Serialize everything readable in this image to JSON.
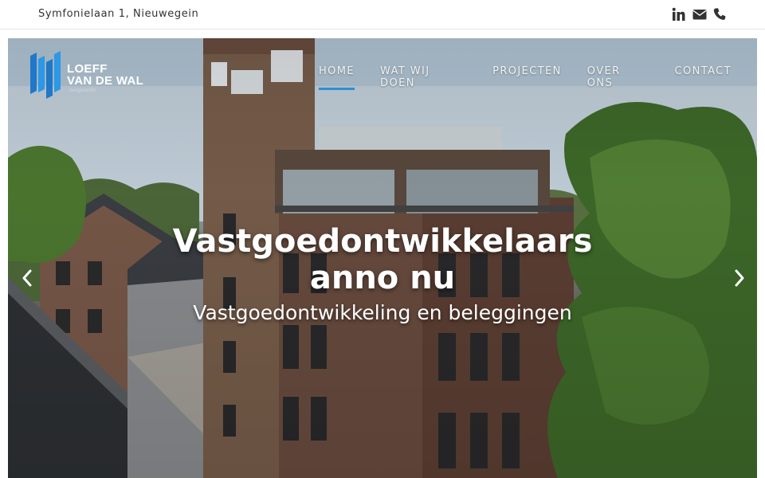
{
  "topbar": {
    "address": "Symfonielaan 1, Nieuwegein",
    "icons": [
      "linkedin-icon",
      "envelope-icon",
      "phone-icon"
    ]
  },
  "logo": {
    "line1": "LOEFF",
    "line2": "VAN DE WAL",
    "sub": "Vastgoed BV"
  },
  "nav": {
    "items": [
      {
        "label": "HOME",
        "active": true
      },
      {
        "label": "WAT WIJ DOEN",
        "active": false
      },
      {
        "label": "PROJECTEN",
        "active": false
      },
      {
        "label": "OVER ONS",
        "active": false
      },
      {
        "label": "CONTACT",
        "active": false
      }
    ],
    "accent": "#2c8ed6"
  },
  "hero": {
    "title": "Vastgoedontwikkelaars anno nu",
    "subtitle": "Vastgoedontwikkeling en beleggingen",
    "prev_icon": "chevron-left-icon",
    "next_icon": "chevron-right-icon"
  }
}
